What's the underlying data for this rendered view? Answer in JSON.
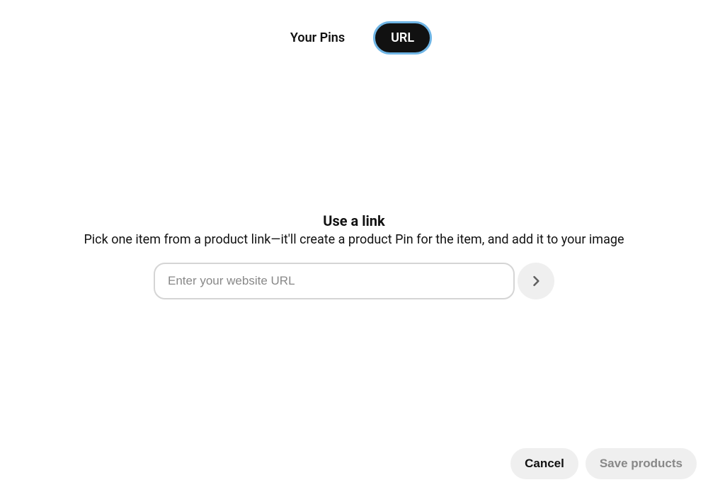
{
  "tabs": {
    "pins_label": "Your Pins",
    "url_label": "URL"
  },
  "main": {
    "heading": "Use a link",
    "subheading": "Pick one item from a product link—it'll create a product Pin for the item, and add it to your image",
    "input_placeholder": "Enter your website URL"
  },
  "footer": {
    "cancel_label": "Cancel",
    "save_label": "Save products"
  }
}
